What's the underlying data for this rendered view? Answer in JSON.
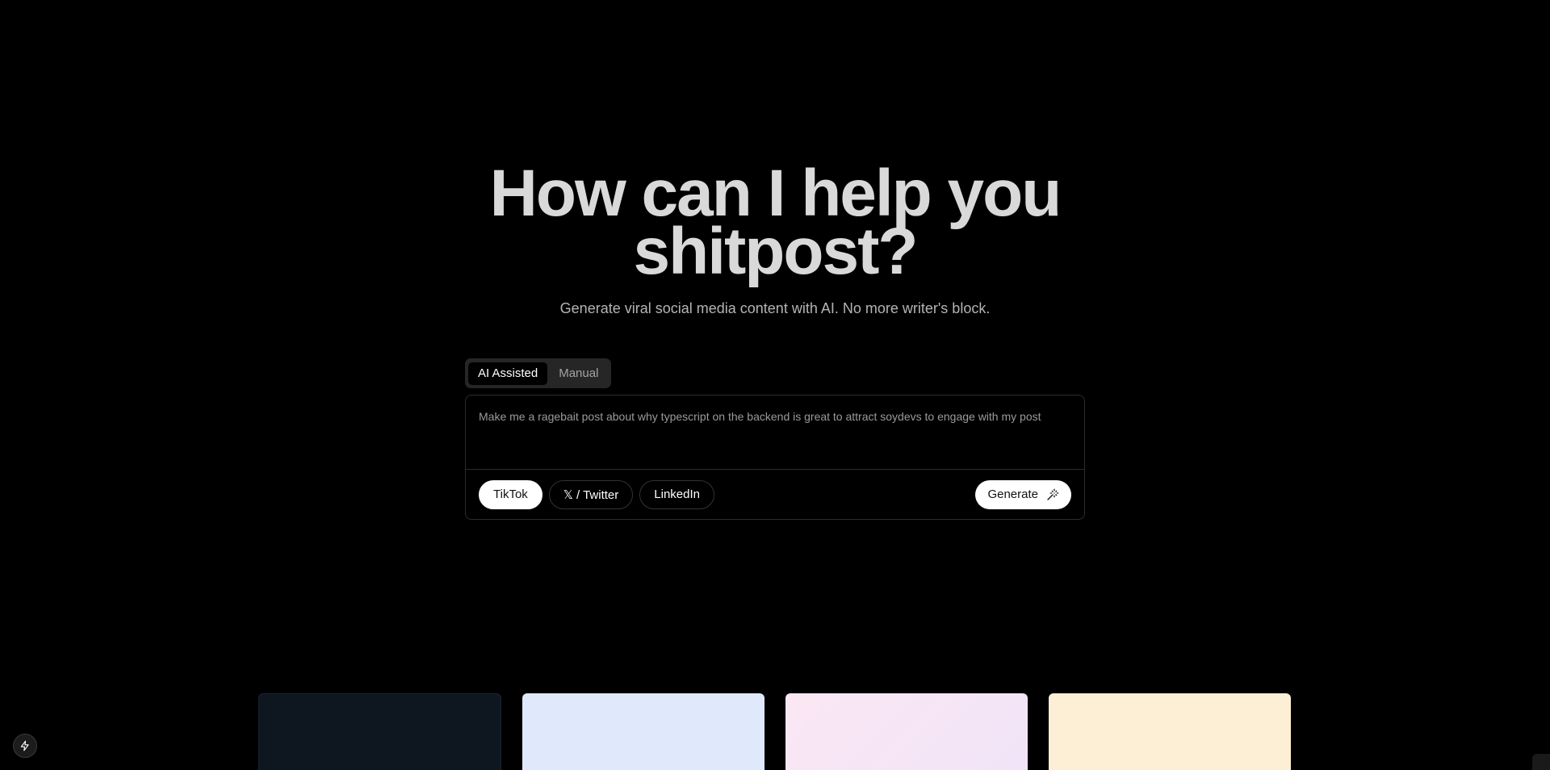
{
  "hero": {
    "title_line1": "How can I help you",
    "title_line2": "shitpost?",
    "subtitle": "Generate viral social media content with AI. No more writer's block."
  },
  "mode_toggle": {
    "options": [
      "AI Assisted",
      "Manual"
    ],
    "selected": "AI Assisted"
  },
  "prompt": {
    "value": "Make me a ragebait post about why typescript on the backend is great to attract soydevs to engage with my post"
  },
  "platforms": {
    "items": [
      "TikTok",
      "𝕏 / Twitter",
      "LinkedIn"
    ],
    "selected": "TikTok"
  },
  "generate": {
    "label": "Generate",
    "icon": "sparkles-icon"
  },
  "fab": {
    "icon": "lightning-icon"
  },
  "colors": {
    "background": "#000000",
    "card_1": "#0e1720",
    "card_2": "#dfe9fb",
    "card_3": "#f5e5f5",
    "card_4": "#fdefd6"
  }
}
